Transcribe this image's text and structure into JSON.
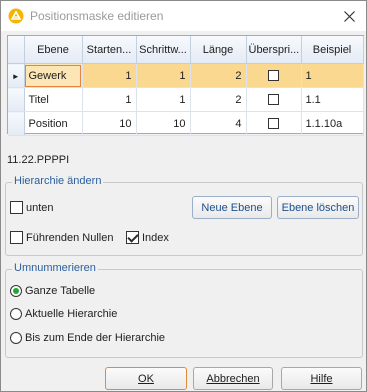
{
  "window": {
    "title": "Positionsmaske editieren"
  },
  "grid": {
    "columns": [
      "Ebene",
      "Starten...",
      "Schrittw...",
      "Länge",
      "Überspri...",
      "Beispiel"
    ],
    "rows": [
      {
        "ebene": "Gewerk",
        "start": "1",
        "schritt": "1",
        "laenge": "2",
        "skip": false,
        "beispiel": "1"
      },
      {
        "ebene": "Titel",
        "start": "1",
        "schritt": "1",
        "laenge": "2",
        "skip": false,
        "beispiel": "1.1"
      },
      {
        "ebene": "Position",
        "start": "10",
        "schritt": "10",
        "laenge": "4",
        "skip": false,
        "beispiel": "1.1.10a"
      }
    ],
    "selected_row": 0
  },
  "mask_code": "11.22.PPPPI",
  "hierarchy": {
    "legend": "Hierarchie ändern",
    "unten_label": "unten",
    "unten_checked": false,
    "new_level_label": "Neue Ebene",
    "delete_level_label": "Ebene löschen",
    "leading_zeros_label": "Führenden Nullen",
    "leading_zeros_checked": false,
    "index_label": "Index",
    "index_checked": true
  },
  "renumber": {
    "legend": "Umnummerieren",
    "options": [
      "Ganze Tabelle",
      "Aktuelle Hierarchie",
      "Bis zum Ende der Hierarchie"
    ],
    "selected": 0
  },
  "buttons": {
    "ok": "OK",
    "cancel": "Abbrechen",
    "help": "Hilfe"
  },
  "colors": {
    "selection": "#fbd88f",
    "accent_blue": "#1b4f8e",
    "radio_green": "#22a633",
    "focus_orange": "#e7843b"
  }
}
